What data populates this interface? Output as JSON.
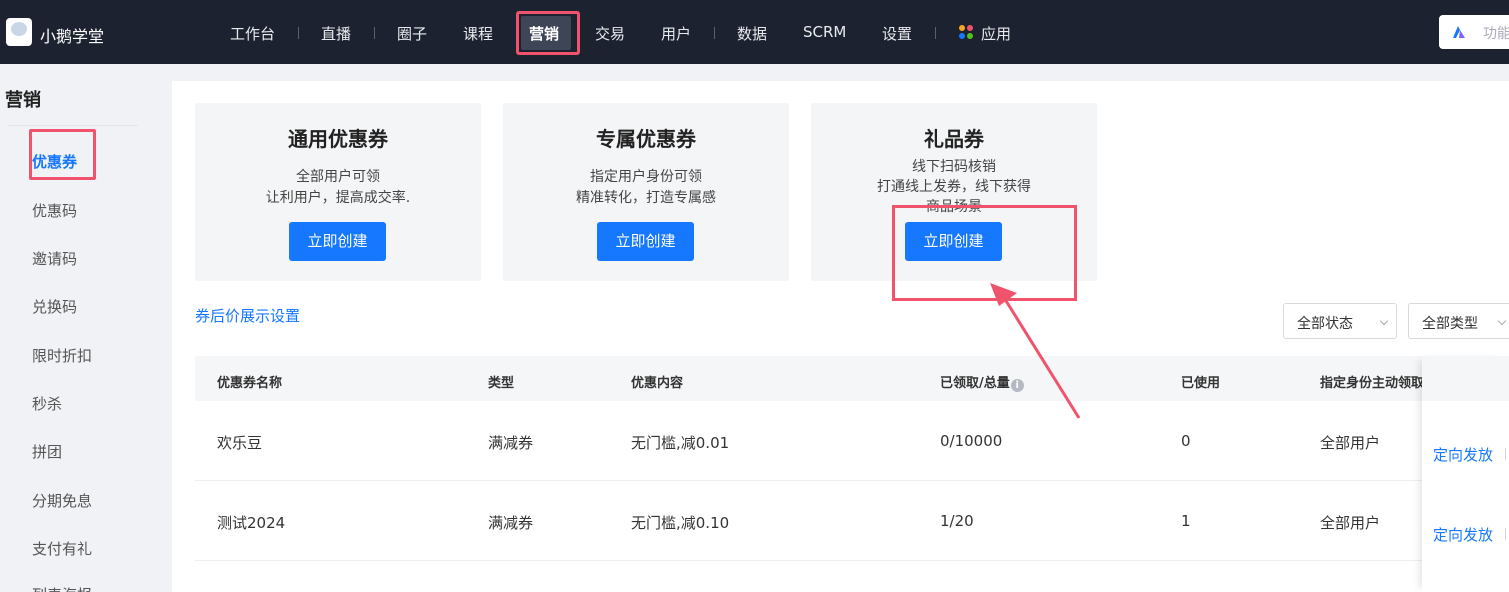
{
  "topbar": {
    "brand": "小鹅学堂",
    "nav": [
      "工作台",
      "直播",
      "圈子",
      "课程",
      "营销",
      "交易",
      "用户",
      "数据",
      "SCRM",
      "设置",
      "应用"
    ],
    "active": "营销",
    "search_placeholder": "功能"
  },
  "sidebar": {
    "title": "营销",
    "items": [
      "优惠券",
      "优惠码",
      "邀请码",
      "兑换码",
      "限时折扣",
      "秒杀",
      "拼团",
      "分期免息",
      "支付有礼",
      "列表海报"
    ],
    "active": "优惠券"
  },
  "cards": [
    {
      "title": "通用优惠券",
      "lines": [
        "全部用户可领",
        "让利用户，提高成交率."
      ],
      "button": "立即创建"
    },
    {
      "title": "专属优惠券",
      "lines": [
        "指定用户身份可领",
        "精准转化，打造专属感"
      ],
      "button": "立即创建"
    },
    {
      "title": "礼品券",
      "lines": [
        "线下扫码核销",
        "打通线上发券，线下获得",
        "商品场景"
      ],
      "button": "立即创建"
    }
  ],
  "toolbar": {
    "setting_link": "券后价展示设置",
    "status_select": "全部状态",
    "type_select": "全部类型"
  },
  "table": {
    "headers": [
      "优惠券名称",
      "类型",
      "优惠内容",
      "已领取/总量",
      "已使用",
      "指定身份主动领取"
    ],
    "info_icon": "i",
    "rows": [
      {
        "name": "欢乐豆",
        "type": "满减券",
        "content": "无门槛,减0.01",
        "claimed": "0/10000",
        "used": "0",
        "identity": "全部用户",
        "action": "定向发放"
      },
      {
        "name": "测试2024",
        "type": "满减券",
        "content": "无门槛,减0.10",
        "claimed": "1/20",
        "used": "1",
        "identity": "全部用户",
        "action": "定向发放"
      }
    ]
  },
  "colors": {
    "topbar": "#1c2230",
    "primary": "#1677ff",
    "highlight": "#f0546c"
  }
}
